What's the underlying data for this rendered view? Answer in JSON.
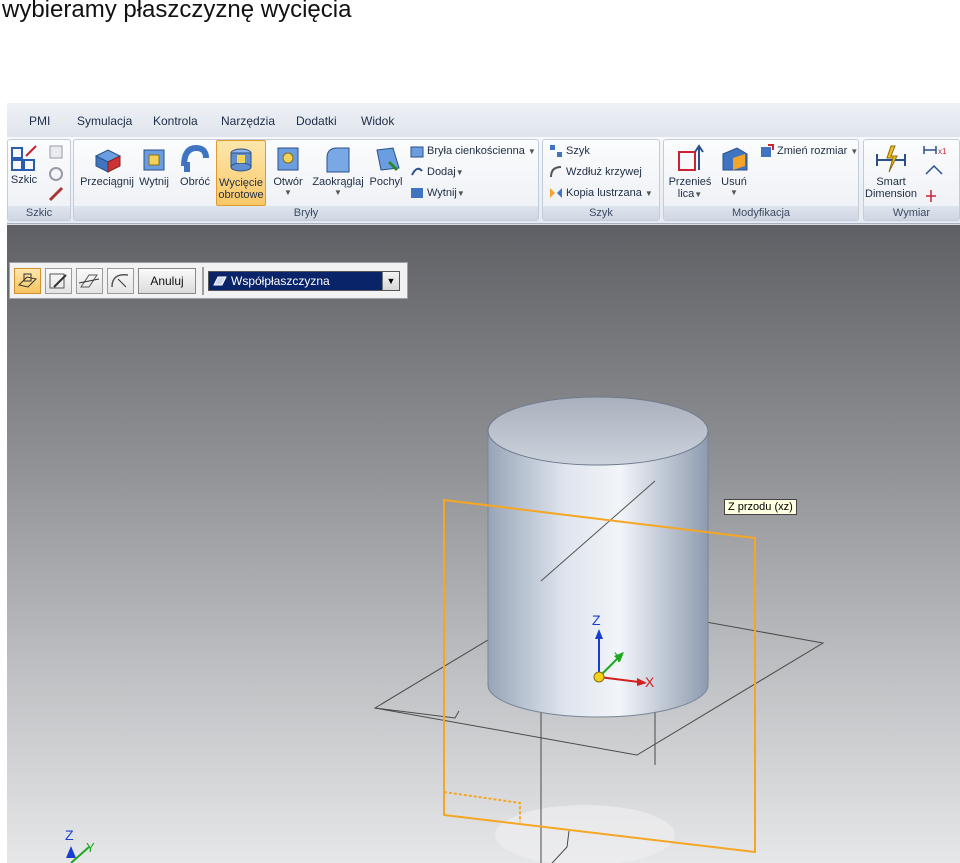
{
  "caption": "wybieramy płaszczyznę wycięcia",
  "menu": [
    "PMI",
    "Symulacja",
    "Kontrola",
    "Narzędzia",
    "Dodatki",
    "Widok"
  ],
  "ribbon": {
    "szkic": {
      "label": "Szkic",
      "group": "Szkic"
    },
    "bryly": {
      "group": "Bryły",
      "buttons": [
        "Przeciągnij",
        "Wytnij",
        "Obróć",
        "Wycięcie",
        "obrotowe",
        "Otwór",
        "Zaokrąglaj",
        "Pochyl"
      ],
      "small": [
        "Bryła cienkościenna",
        "Dodaj",
        "Wytnij"
      ]
    },
    "szyk": {
      "group": "Szyk",
      "small": [
        "Szyk",
        "Wzdłuż krzywej",
        "Kopia lustrzana"
      ]
    },
    "modyfikacja": {
      "group": "Modyfikacja",
      "przenies1": "Przenieś",
      "przenies2": "lica",
      "usun": "Usuń",
      "zmien": "Zmień rozmiar"
    },
    "wymiar": {
      "group": "Wymiar",
      "smart1": "Smart",
      "smart2": "Dimension"
    }
  },
  "commandbar": {
    "cancel": "Anuluj",
    "plane_select": "Współpłaszczyzna"
  },
  "tooltip": "Z przodu (xz)",
  "axes": {
    "z": "Z",
    "y": "Y",
    "x": "X"
  },
  "colors": {
    "selection": "#f5a623",
    "active_button": "#f8c868"
  }
}
